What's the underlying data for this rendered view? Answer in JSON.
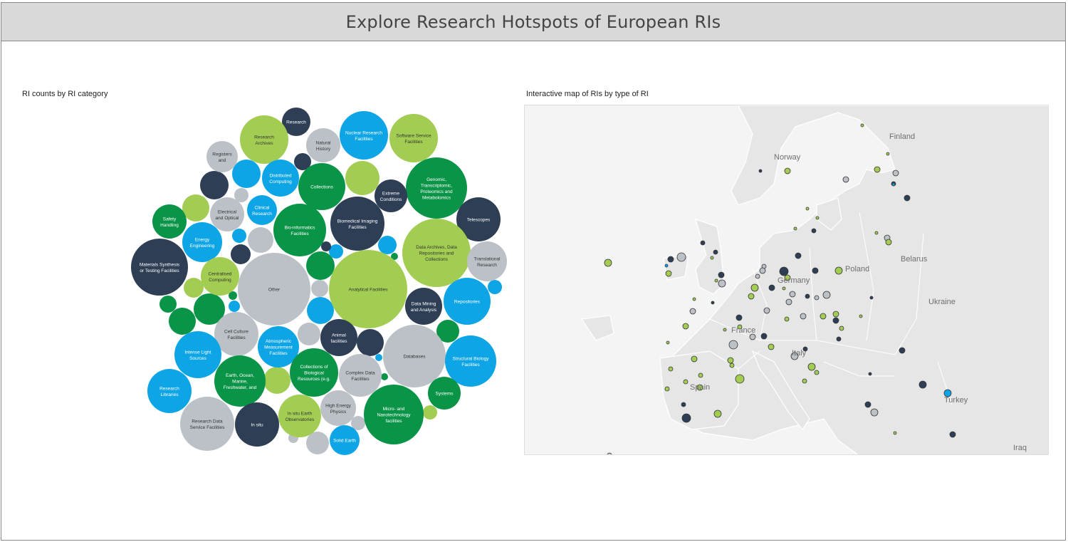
{
  "header": {
    "title": "Explore Research Hotspots of European RIs"
  },
  "left_panel": {
    "title": "RI counts by RI category"
  },
  "right_panel": {
    "title": "Interactive map of RIs by type of RI"
  },
  "colors": {
    "dark": "#2e3e55",
    "green": "#0a9447",
    "light_green": "#a3cd52",
    "blue": "#0ea5e6",
    "grey": "#bcc1c7"
  },
  "bubbles": [
    {
      "label": "Research",
      "lines": [
        "Research"
      ],
      "color": "dark"
    },
    {
      "label": "Research Archives",
      "lines": [
        "Research",
        "Archives"
      ],
      "color": "light_green"
    },
    {
      "label": "Natural History",
      "lines": [
        "Natural",
        "History"
      ],
      "color": "grey"
    },
    {
      "label": "Nuclear Research Facilities",
      "lines": [
        "Nuclear Research",
        "Facilities"
      ],
      "color": "blue"
    },
    {
      "label": "Software Service Facilities",
      "lines": [
        "Software Service",
        "Facilities"
      ],
      "color": "light_green"
    },
    {
      "label": "Registers and",
      "lines": [
        "Registers",
        "and"
      ],
      "color": "grey"
    },
    {
      "label": "Distributed Computing",
      "lines": [
        "Distributed",
        "Computing"
      ],
      "color": "blue"
    },
    {
      "label": "Collections",
      "lines": [
        "Collections"
      ],
      "color": "green"
    },
    {
      "label": "Genomic, Transcriptomic, Proteomics and Metabolomics",
      "lines": [
        "Genomic,",
        "Transcriptomic,",
        "Proteomics and",
        "Metabolomics"
      ],
      "color": "green"
    },
    {
      "label": "Extreme Conditions",
      "lines": [
        "Extreme",
        "Conditions"
      ],
      "color": "dark"
    },
    {
      "label": "Electrical and Optical",
      "lines": [
        "Electrical",
        "and Optical"
      ],
      "color": "grey"
    },
    {
      "label": "Clinical Research",
      "lines": [
        "Clinical",
        "Research"
      ],
      "color": "blue"
    },
    {
      "label": "Safety Handling",
      "lines": [
        "Safety",
        "Handling"
      ],
      "color": "green"
    },
    {
      "label": "Bio-informatics Facilities",
      "lines": [
        "Bio-informatics",
        "Facilities"
      ],
      "color": "green"
    },
    {
      "label": "Biomedical Imaging Facilities",
      "lines": [
        "Biomedical Imaging",
        "Facilities"
      ],
      "color": "dark"
    },
    {
      "label": "Telescopes",
      "lines": [
        "Telescopes"
      ],
      "color": "dark"
    },
    {
      "label": "Energy Engineering",
      "lines": [
        "Energy",
        "Engineering"
      ],
      "color": "blue"
    },
    {
      "label": "Data Archives, Data Repositories and Collections",
      "lines": [
        "Data Archives, Data",
        "Repositories and",
        "Collections"
      ],
      "color": "light_green"
    },
    {
      "label": "Translational Research",
      "lines": [
        "Translational",
        "Research"
      ],
      "color": "grey"
    },
    {
      "label": "Materials Synthesis or Testing Facilities",
      "lines": [
        "Materials Synthesis",
        "or Testing Facilities"
      ],
      "color": "dark"
    },
    {
      "label": "Centralised Computing",
      "lines": [
        "Centralised",
        "Computing"
      ],
      "color": "light_green"
    },
    {
      "label": "Other",
      "lines": [
        "Other"
      ],
      "color": "grey"
    },
    {
      "label": "Analytical Facilities",
      "lines": [
        "Analytical Facilities"
      ],
      "color": "light_green"
    },
    {
      "label": "Repositories",
      "lines": [
        "Repositories"
      ],
      "color": "blue"
    },
    {
      "label": "Data Mining and Analysis",
      "lines": [
        "Data Mining",
        "and Analysis"
      ],
      "color": "dark"
    },
    {
      "label": "Cell Culture Facilities",
      "lines": [
        "Cell Culture",
        "Facilities"
      ],
      "color": "grey"
    },
    {
      "label": "Animal facilities",
      "lines": [
        "Animal",
        "facilities"
      ],
      "color": "dark"
    },
    {
      "label": "Atmospheric Measurement Facilities",
      "lines": [
        "Atmospheric",
        "Measurement",
        "Facilities"
      ],
      "color": "blue"
    },
    {
      "label": "Intense Light Sources",
      "lines": [
        "Intense Light",
        "Sources"
      ],
      "color": "blue"
    },
    {
      "label": "Databases",
      "lines": [
        "Databases"
      ],
      "color": "grey"
    },
    {
      "label": "Structural Biology Facilities",
      "lines": [
        "Structural Biology",
        "Facilities"
      ],
      "color": "blue"
    },
    {
      "label": "Collections of Biological Resources (e.g.",
      "lines": [
        "Collections of",
        "Biological",
        "Resources (e.g."
      ],
      "color": "green"
    },
    {
      "label": "Complex Data Facilities",
      "lines": [
        "Complex Data",
        "Facilities"
      ],
      "color": "grey"
    },
    {
      "label": "Earth, Ocean, Marine, Freshwater, and",
      "lines": [
        "Earth, Ocean,",
        "Marine,",
        "Freshwater, and"
      ],
      "color": "green"
    },
    {
      "label": "Research Libraries",
      "lines": [
        "Research",
        "Libraries"
      ],
      "color": "blue"
    },
    {
      "label": "Systems",
      "lines": [
        "Systems"
      ],
      "color": "green"
    },
    {
      "label": "High Energy Physics",
      "lines": [
        "High Energy",
        "Physics"
      ],
      "color": "grey"
    },
    {
      "label": "Micro- and Nanotechnology facilities",
      "lines": [
        "Micro- and",
        "Nanotechnology",
        "facilities"
      ],
      "color": "green"
    },
    {
      "label": "Research Data Service Facilities",
      "lines": [
        "Research Data",
        "Service Facilities"
      ],
      "color": "grey"
    },
    {
      "label": "In situ",
      "lines": [
        "In situ"
      ],
      "color": "dark"
    },
    {
      "label": "In situ Earth Observatories",
      "lines": [
        "In situ Earth",
        "Observatories"
      ],
      "color": "light_green"
    },
    {
      "label": "Solid Earth",
      "lines": [
        "Solid Earth"
      ],
      "color": "blue"
    }
  ],
  "map": {
    "labels": [
      "Finland",
      "Norway",
      "Poland",
      "Belarus",
      "Ukraine",
      "Germany",
      "France",
      "Italy",
      "Spain",
      "Turkey",
      "Iraq"
    ]
  }
}
